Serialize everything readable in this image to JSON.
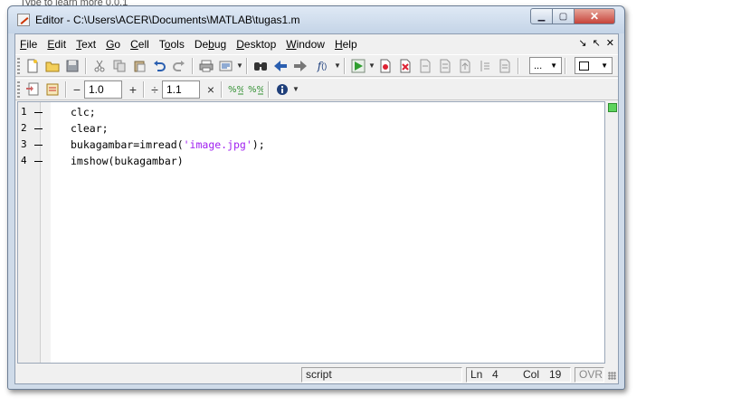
{
  "background": {
    "partial_text": "Type to learn more 0.0.1"
  },
  "window": {
    "title": "Editor - C:\\Users\\ACER\\Documents\\MATLAB\\tugas1.m",
    "controls": {
      "minimize": "minimize-icon",
      "maximize": "maximize-icon",
      "close": "close-icon"
    }
  },
  "menu": {
    "items": [
      {
        "ul": "F",
        "rest": "ile"
      },
      {
        "ul": "E",
        "rest": "dit"
      },
      {
        "ul": "T",
        "rest": "ext"
      },
      {
        "ul": "G",
        "rest": "o"
      },
      {
        "ul": "C",
        "rest": "ell"
      },
      {
        "pre": "T",
        "ul": "o",
        "rest": "ols"
      },
      {
        "pre": "De",
        "ul": "b",
        "rest": "ug"
      },
      {
        "ul": "D",
        "rest": "esktop"
      },
      {
        "ul": "W",
        "rest": "indow"
      },
      {
        "ul": "H",
        "rest": "elp"
      }
    ],
    "right_controls": {
      "undock": "↘",
      "dock": "↖",
      "close": "✕"
    }
  },
  "toolbar1": {
    "stack_value": "...",
    "icons": [
      "new-file-icon",
      "open-folder-icon",
      "save-icon",
      "cut-icon",
      "copy-icon",
      "paste-icon",
      "undo-icon",
      "redo-icon",
      "print-icon",
      "publish-icon",
      "find-icon",
      "back-icon",
      "forward-icon",
      "function-icon",
      "run-icon",
      "set-breakpoint-icon",
      "clear-breakpoint-icon",
      "step-icon",
      "step-in-icon",
      "step-out-icon",
      "continue-icon",
      "exit-debug-icon",
      "stack-combo",
      "dock-layout-combo"
    ]
  },
  "toolbar2": {
    "decrement_symbol": "−",
    "value1": "1.0",
    "increment_symbol": "+",
    "divide_symbol": "÷",
    "value2": "1.1",
    "multiply_symbol": "×"
  },
  "editor": {
    "lines": [
      {
        "number": "1",
        "segments": [
          {
            "text": "clc;",
            "type": "code"
          }
        ]
      },
      {
        "number": "2",
        "segments": [
          {
            "text": "clear;",
            "type": "code"
          }
        ]
      },
      {
        "number": "3",
        "segments": [
          {
            "text": "bukagambar=imread(",
            "type": "code"
          },
          {
            "text": "'image.jpg'",
            "type": "string"
          },
          {
            "text": ");",
            "type": "code"
          }
        ]
      },
      {
        "number": "4",
        "segments": [
          {
            "text": "imshow(bukagambar)",
            "type": "code"
          }
        ]
      }
    ],
    "string_color": "#a020f0",
    "status_indicator_color": "#5ed45e"
  },
  "status": {
    "file_type": "script",
    "ln_label": "Ln",
    "ln_value": "4",
    "col_label": "Col",
    "col_value": "19",
    "ovr": "OVR"
  }
}
